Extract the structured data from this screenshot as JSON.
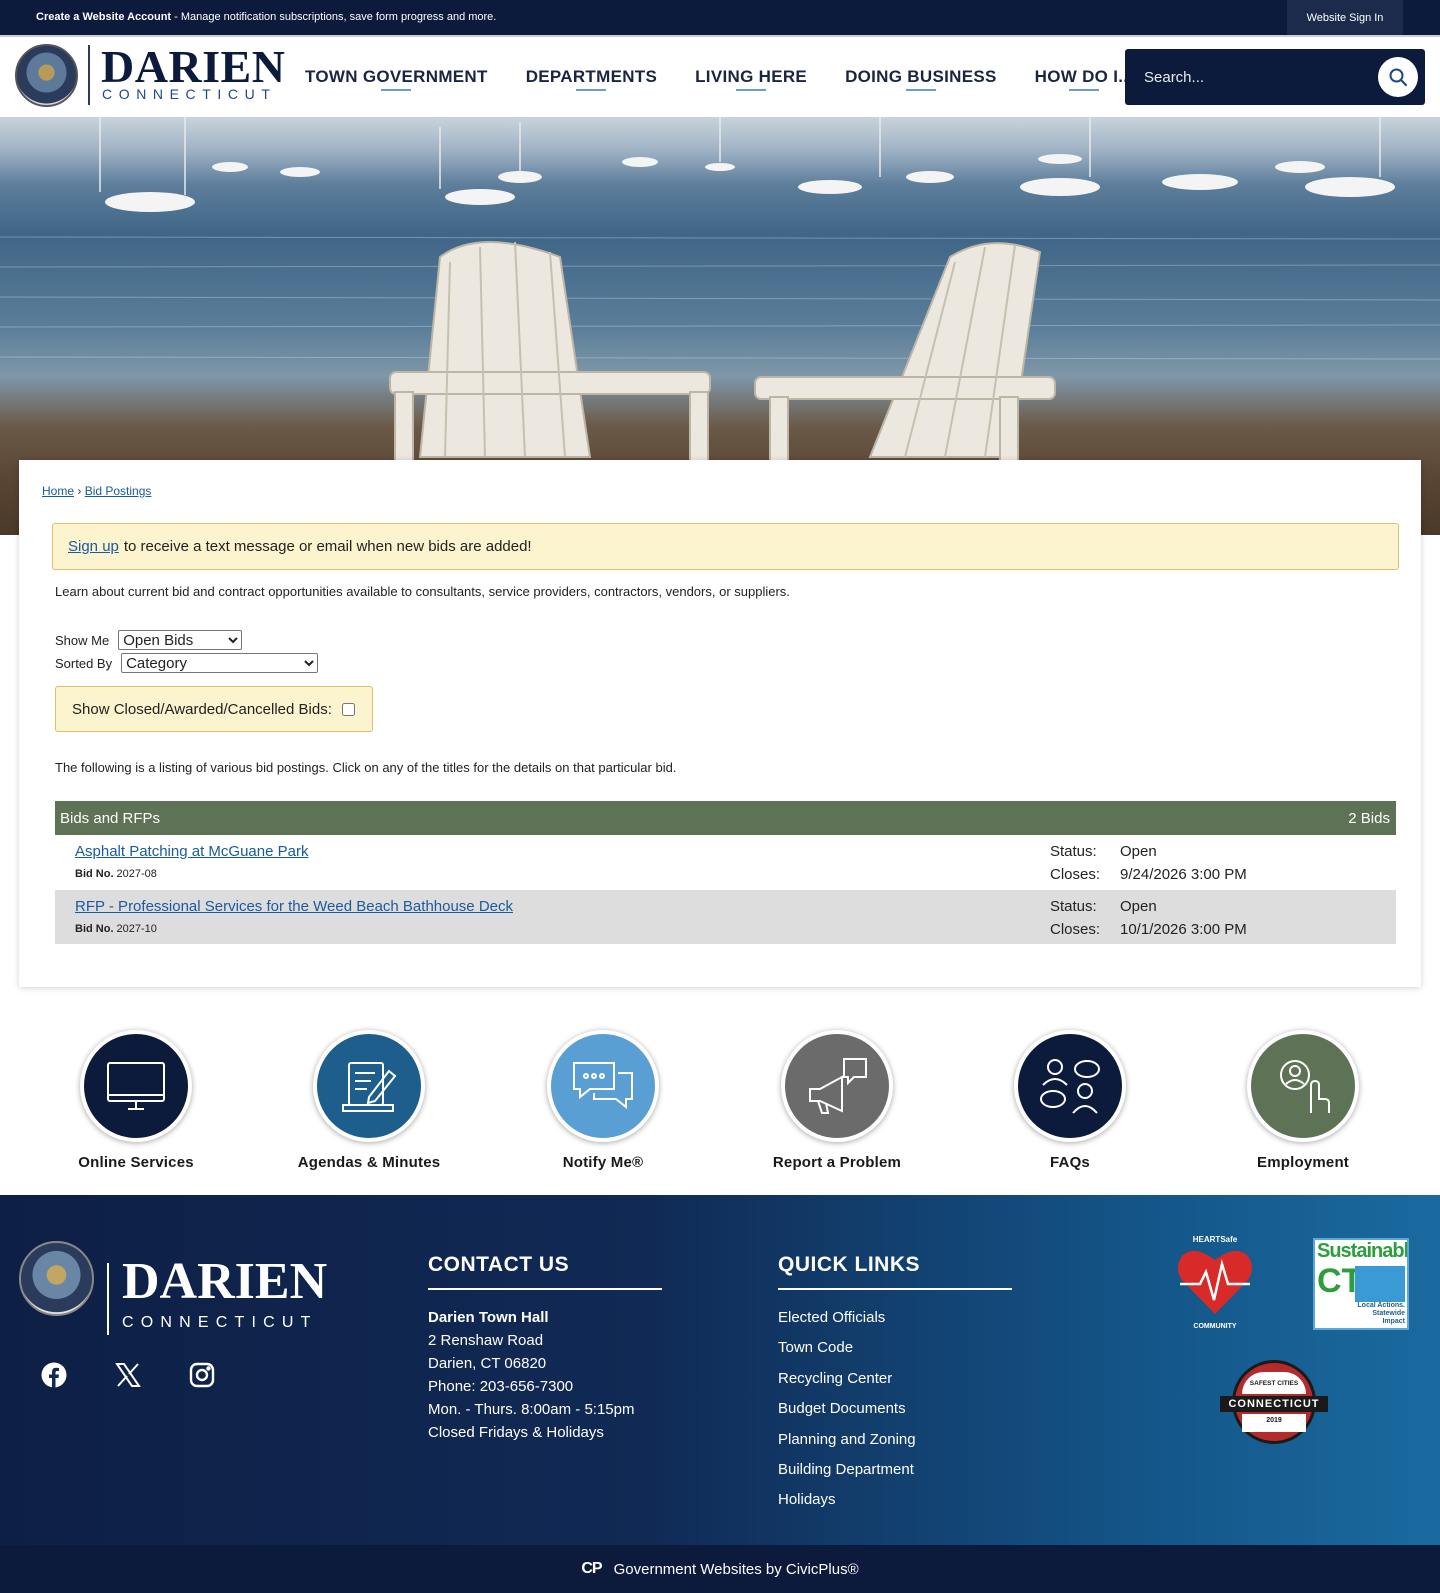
{
  "topbar": {
    "create_account_link": "Create a Website Account",
    "create_account_suffix": " - Manage notification subscriptions, save form progress and more.",
    "sign_in": "Website Sign In"
  },
  "header": {
    "logo_name": "DARIEN",
    "logo_state": "CONNECTICUT",
    "nav": [
      "TOWN GOVERNMENT",
      "DEPARTMENTS",
      "LIVING HERE",
      "DOING BUSINESS",
      "HOW DO I..."
    ],
    "search_placeholder": "Search..."
  },
  "breadcrumb": {
    "home": "Home",
    "sep": "›",
    "current": "Bid Postings"
  },
  "alert": {
    "link": "Sign up",
    "text": "to receive a text message or email when new bids are added!"
  },
  "intro": "Learn about current bid and contract opportunities available to consultants, service providers, contractors, vendors, or suppliers.",
  "filters": {
    "show_me_label": "Show Me",
    "show_me_value": "Open Bids",
    "sorted_by_label": "Sorted By",
    "sorted_by_value": "Category",
    "closed_label": "Show Closed/Awarded/Cancelled Bids:"
  },
  "listing_note": "The following is a listing of various bid postings. Click on any of the titles for the details on that particular bid.",
  "bids": {
    "category": "Bids and RFPs",
    "count": "2 Bids",
    "bid_no_label": "Bid No.",
    "status_label": "Status:",
    "closes_label": "Closes:",
    "items": [
      {
        "title": "Asphalt Patching at McGuane Park",
        "bid_no": "2027-08",
        "status": "Open",
        "closes": "9/24/2026 3:00 PM"
      },
      {
        "title": "RFP - Professional Services for the Weed Beach Bathhouse Deck",
        "bid_no": "2027-10",
        "status": "Open",
        "closes": "10/1/2026 3:00 PM"
      }
    ]
  },
  "quick_links": [
    {
      "label": "Online Services",
      "icon": "monitor-icon",
      "color": "#0c1a3c"
    },
    {
      "label": "Agendas & Minutes",
      "icon": "document-pen-icon",
      "color": "#1e5e8c"
    },
    {
      "label": "Notify Me®",
      "icon": "chat-bubbles-icon",
      "color": "#5a9fd4"
    },
    {
      "label": "Report a Problem",
      "icon": "megaphone-icon",
      "color": "#6b6b6b"
    },
    {
      "label": "FAQs",
      "icon": "people-chat-icon",
      "color": "#0c1a3c"
    },
    {
      "label": "Employment",
      "icon": "person-hand-icon",
      "color": "#5e7355"
    }
  ],
  "footer": {
    "logo_name": "DARIEN",
    "logo_state": "CONNECTICUT",
    "contact_heading": "CONTACT US",
    "contact_lines": [
      "Darien Town Hall",
      "2 Renshaw Road",
      "Darien, CT 06820",
      "Phone: 203-656-7300",
      "Mon. - Thurs. 8:00am - 5:15pm",
      "Closed Fridays & Holidays"
    ],
    "quick_heading": "QUICK LINKS",
    "quick_links": [
      "Elected Officials",
      "Town Code",
      "Recycling Center",
      "Budget Documents",
      "Planning and Zoning",
      "Building Department",
      "Holidays"
    ],
    "badges": {
      "heartsafe_top": "HEARTSafe",
      "heartsafe_bottom": "COMMUNITY",
      "sustainable": "Sustainable",
      "ct": "CT",
      "sustainable_tag": "Local Actions. Statewide Impact",
      "safest_top": "SAFEST CITIES",
      "safest_state": "CONNECTICUT",
      "safest_year": "2019"
    }
  },
  "bottombar": {
    "logo": "CP",
    "text": "Government Websites by CivicPlus®"
  }
}
